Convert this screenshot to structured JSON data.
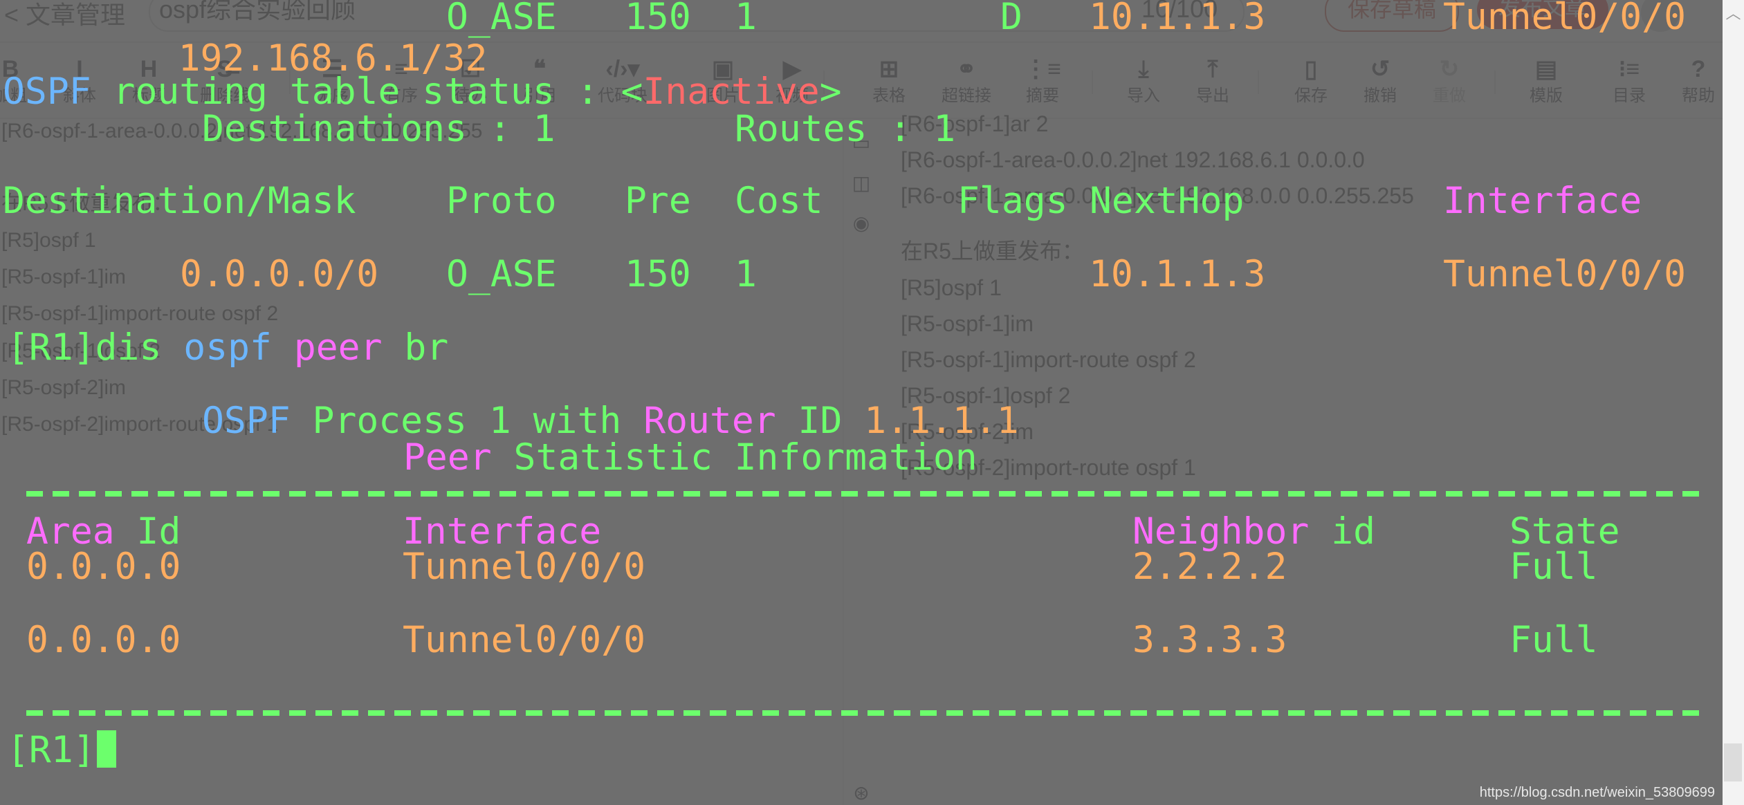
{
  "editor": {
    "back_label": "< 文章管理",
    "title_value": "ospf综合实验回顾",
    "title_counter": "10/100",
    "save_draft_label": "保存草稿",
    "publish_label": "发布文章",
    "toolbar": [
      {
        "icon": "B",
        "label": "加粗",
        "name": "bold"
      },
      {
        "icon": "I",
        "label": "斜体",
        "name": "italic"
      },
      {
        "icon": "H",
        "label": "标题",
        "name": "heading"
      },
      {
        "icon": "S̶",
        "label": "删除线",
        "name": "strikethrough"
      },
      {
        "icon": "☰",
        "label": "无序",
        "name": "unordered-list"
      },
      {
        "icon": "≡",
        "label": "有序",
        "name": "ordered-list"
      },
      {
        "icon": "☑",
        "label": "待办",
        "name": "todo"
      },
      {
        "icon": "❝",
        "label": "引用",
        "name": "quote"
      },
      {
        "icon": "‹/›▾",
        "label": "代码块",
        "name": "code-block"
      },
      {
        "icon": "▣",
        "label": "图片",
        "name": "image"
      },
      {
        "icon": "▶",
        "label": "视频",
        "name": "video"
      },
      {
        "icon": "⊞",
        "label": "表格",
        "name": "table"
      },
      {
        "icon": "⚭",
        "label": "超链接",
        "name": "hyperlink"
      },
      {
        "icon": "⋮≡",
        "label": "摘要",
        "name": "summary"
      },
      {
        "icon": "⤓",
        "label": "导入",
        "name": "import"
      },
      {
        "icon": "⤒",
        "label": "导出",
        "name": "export"
      },
      {
        "icon": "▯",
        "label": "保存",
        "name": "save"
      },
      {
        "icon": "↺",
        "label": "撤销",
        "name": "undo"
      },
      {
        "icon": "↻",
        "label": "重做",
        "name": "redo",
        "disabled": true
      },
      {
        "icon": "▤",
        "label": "模版",
        "name": "template"
      },
      {
        "icon": "⁝≡",
        "label": "目录",
        "name": "toc"
      },
      {
        "icon": "?",
        "label": "帮助",
        "name": "help"
      }
    ],
    "markdown_lines": [
      "[R6-ospf-1-area-0.0.0.2]net 192.168.0.0 0.0.255.255",
      "在R5上做重发布：",
      "[R5]ospf 1",
      "[R5-ospf-1]im",
      "[R5-ospf-1]import-route ospf 2",
      "[R5-ospf-1]ospf 2",
      "[R5-ospf-2]im",
      "[R5-ospf-2]import-route ospf 1"
    ],
    "preview_lines": [
      "[R6-ospf-1]ar 2",
      "[R6-ospf-1-area-0.0.0.2]net 192.168.6.1 0.0.0.0",
      "[R6-ospf-1-area-0.0.0.2]net 192.168.0.0 0.0.255.255",
      "在R5上做重发布：",
      "[R5]ospf 1",
      "[R5-ospf-1]im",
      "[R5-ospf-1]import-route ospf 2",
      "[R5-ospf-1]ospf 2",
      "[R5-ospf-2]im",
      "[R5-ospf-2]import-route ospf 1"
    ],
    "watermark": "https://blog.csdn.net/weixin_53809699"
  },
  "terminal": {
    "route_row_top": {
      "dest": "192.168.6.1/32",
      "proto": "O_ASE",
      "pre": "150",
      "cost": "1",
      "flags": "D",
      "nexthop": "10.1.1.3",
      "interface": "Tunnel0/0/0"
    },
    "status_line": {
      "ospf": "OSPF",
      "text": " routing table status : ",
      "lt": "<",
      "state": "Inactive",
      "gt": ">"
    },
    "destinations_label": "Destinations : ",
    "destinations_value": "1",
    "routes_label": "Routes : ",
    "routes_value": "1",
    "route_headers": {
      "dest": "Destination/Mask",
      "proto": "Proto",
      "pre": "Pre",
      "cost": "Cost",
      "flags": "Flags",
      "nexthop": "NextHop",
      "interface": "Interface"
    },
    "route_row_inactive": {
      "dest": "0.0.0.0/0",
      "proto": "O_ASE",
      "pre": "150",
      "cost": "1",
      "nexthop": "10.1.1.3",
      "interface": "Tunnel0/0/0"
    },
    "command": {
      "prompt": "[R1]",
      "verb": "dis",
      "arg1": "ospf",
      "arg2": "peer",
      "arg3": "br"
    },
    "process_line": {
      "ospf": "OSPF",
      "process": " Process 1 with ",
      "router": "Router",
      "id": " ID ",
      "router_id": "1.1.1.1"
    },
    "peer_title": {
      "peer": "Peer",
      "rest": " Statistic Information"
    },
    "peer_headers": {
      "area_a": "Area",
      "area_b": " Id",
      "interface": "Interface",
      "neighbor_a": "Neighbor",
      "neighbor_b": " id",
      "state": "State"
    },
    "peers": [
      {
        "area": "0.0.0.0",
        "interface": "Tunnel0/0/0",
        "neighbor": "2.2.2.2",
        "state": "Full"
      },
      {
        "area": "0.0.0.0",
        "interface": "Tunnel0/0/0",
        "neighbor": "3.3.3.3",
        "state": "Full"
      }
    ],
    "prompt": "[R1]"
  },
  "colors": {
    "green": "#6cff6c",
    "orange": "#ffad60",
    "magenta": "#ff6cff",
    "blue": "#6cb6ff",
    "red": "#ff6a6a",
    "overlay": "#5a5a5a"
  }
}
